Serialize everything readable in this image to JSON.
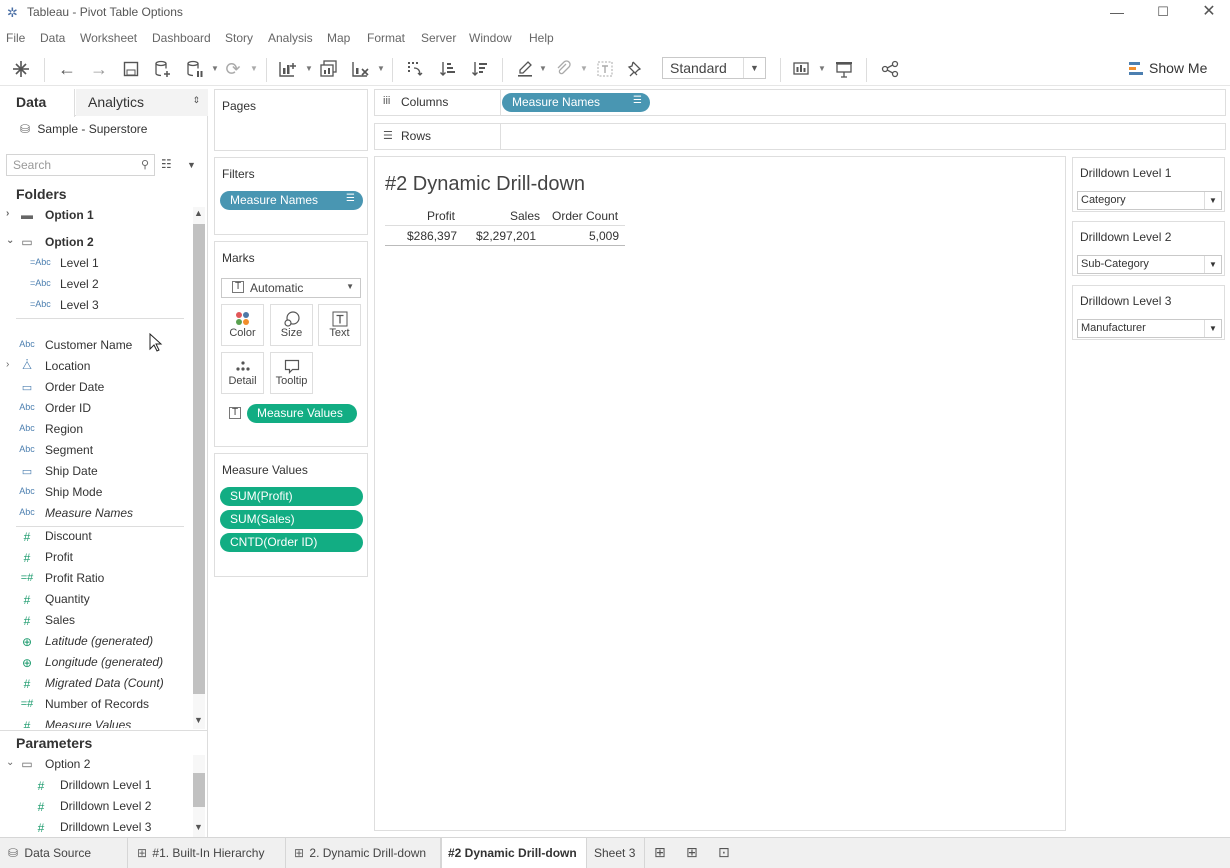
{
  "window": {
    "title": "Tableau - Pivot Table Options"
  },
  "menu": [
    "File",
    "Data",
    "Worksheet",
    "Dashboard",
    "Story",
    "Analysis",
    "Map",
    "Format",
    "Server",
    "Window",
    "Help"
  ],
  "toolbar": {
    "fit_select": "Standard",
    "show_me": "Show Me"
  },
  "left_pane": {
    "tab_data": "Data",
    "tab_analytics": "Analytics",
    "datasource": "Sample - Superstore",
    "search_placeholder": "Search",
    "folders_header": "Folders",
    "folders": [
      {
        "name": "Option 1",
        "expanded": false
      },
      {
        "name": "Option 2",
        "expanded": true,
        "children": [
          "Level 1",
          "Level 2",
          "Level 3"
        ]
      }
    ],
    "dimensions": [
      {
        "label": "Customer Name",
        "icon": "abc-icon"
      },
      {
        "label": "Location",
        "icon": "hierarchy-icon"
      },
      {
        "label": "Order Date",
        "icon": "calendar-icon"
      },
      {
        "label": "Order ID",
        "icon": "abc-icon"
      },
      {
        "label": "Region",
        "icon": "abc-icon"
      },
      {
        "label": "Segment",
        "icon": "abc-icon"
      },
      {
        "label": "Ship Date",
        "icon": "calendar-icon"
      },
      {
        "label": "Ship Mode",
        "icon": "abc-icon"
      },
      {
        "label": "Measure Names",
        "icon": "abc-icon"
      }
    ],
    "measures": [
      {
        "label": "Discount",
        "icon": "number-icon"
      },
      {
        "label": "Profit",
        "icon": "number-icon"
      },
      {
        "label": "Profit Ratio",
        "icon": "calc-number-icon"
      },
      {
        "label": "Quantity",
        "icon": "number-icon"
      },
      {
        "label": "Sales",
        "icon": "number-icon"
      },
      {
        "label": "Latitude (generated)",
        "icon": "globe-icon"
      },
      {
        "label": "Longitude (generated)",
        "icon": "globe-icon"
      },
      {
        "label": "Migrated Data (Count)",
        "icon": "number-icon"
      },
      {
        "label": "Number of Records",
        "icon": "calc-number-icon"
      },
      {
        "label": "Measure Values",
        "icon": "number-icon"
      }
    ],
    "parameters_header": "Parameters",
    "param_folder": "Option 2",
    "parameters": [
      "Drilldown Level 1",
      "Drilldown Level 2",
      "Drilldown Level 3"
    ]
  },
  "shelves": {
    "pages": "Pages",
    "filters": "Filters",
    "filter_pill": "Measure Names",
    "marks": "Marks",
    "mark_type": "Automatic",
    "mark_buttons": [
      "Color",
      "Size",
      "Text",
      "Detail",
      "Tooltip"
    ],
    "marks_pill": "Measure Values",
    "measure_values_header": "Measure Values",
    "measure_values": [
      "SUM(Profit)",
      "SUM(Sales)",
      "CNTD(Order ID)"
    ],
    "columns_label": "Columns",
    "columns_pill": "Measure Names",
    "rows_label": "Rows"
  },
  "view": {
    "title": "#2  Dynamic Drill-down",
    "headers": [
      "Profit",
      "Sales",
      "Order Count"
    ],
    "values": [
      "$286,397",
      "$2,297,201",
      "5,009"
    ]
  },
  "params": [
    {
      "label": "Drilldown Level 1",
      "value": "Category"
    },
    {
      "label": "Drilldown Level 2",
      "value": "Sub-Category"
    },
    {
      "label": "Drilldown Level 3",
      "value": "Manufacturer"
    }
  ],
  "bottom_tabs": {
    "data_source": "Data Source",
    "sheets": [
      "#1. Built-In Hierarchy",
      "2. Dynamic Drill-down",
      "#2  Dynamic Drill-down",
      "Sheet 3"
    ]
  }
}
